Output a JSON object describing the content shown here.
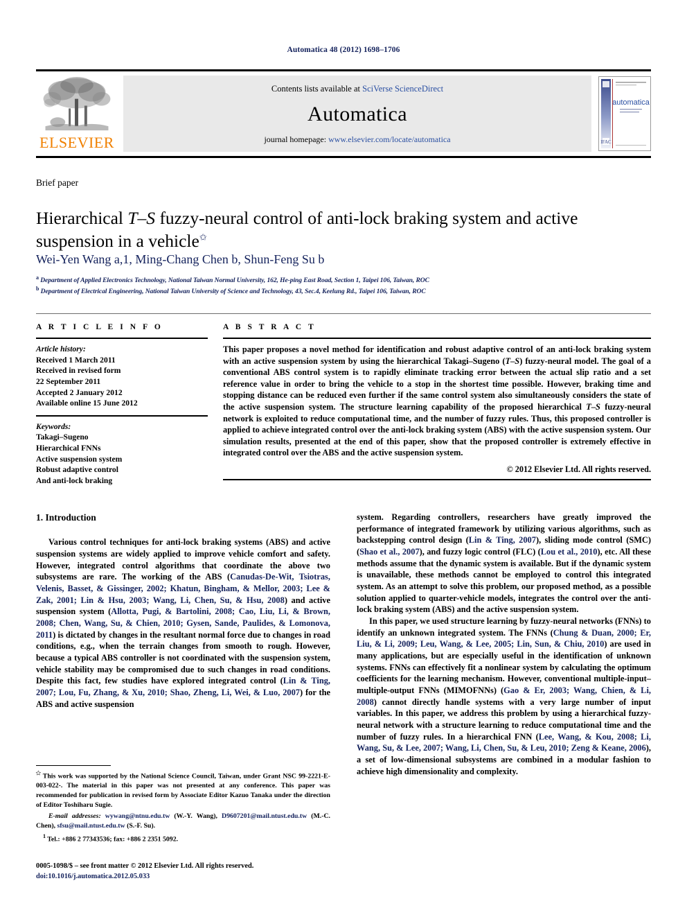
{
  "running_head": "Automatica 48 (2012) 1698–1706",
  "masthead": {
    "contents_prefix": "Contents lists available at ",
    "contents_link": "SciVerse ScienceDirect",
    "journal_name": "Automatica",
    "homepage_prefix": "journal homepage: ",
    "homepage_url": "www.elsevier.com/locate/automatica",
    "publisher": "ELSEVIER",
    "cover_title": "automatica",
    "cover_subtitle_1": "A JOURNAL OF IFAC THE INTERNATIONAL",
    "cover_subtitle_2": "FEDERATION OF AUTOMATIC CONTROL"
  },
  "article": {
    "type_label": "Brief paper",
    "title_part1": "Hierarchical ",
    "title_ts": "T–S",
    "title_part2": " fuzzy-neural control of anti-lock braking system and active suspension in a vehicle",
    "title_star": "✩",
    "authors": "Wei-Yen Wang a,1, Ming-Chang Chen b, Shun-Feng Su b",
    "affiliation_a": "Department of Applied Electronics Technology, National Taiwan Normal University, 162, He-ping East Road, Section 1, Taipei 106, Taiwan, ROC",
    "affiliation_b": "Department of Electrical Engineering, National Taiwan University of Science and Technology, 43, Sec.4, Keelung Rd., Taipei 106, Taiwan, ROC"
  },
  "article_info": {
    "heading": "A R T I C L E   I N F O",
    "history_label": "Article history:",
    "history": [
      "Received 1 March 2011",
      "Received in revised form",
      "22 September 2011",
      "Accepted 2 January 2012",
      "Available online 15 June 2012"
    ],
    "keywords_label": "Keywords:",
    "keywords": [
      "Takagi–Sugeno",
      "Hierarchical FNNs",
      "Active suspension system",
      "Robust adaptive control",
      "And anti-lock braking"
    ]
  },
  "abstract": {
    "heading": "A B S T R A C T",
    "text_1": "This paper proposes a novel method for identification and robust adaptive control of an anti-lock braking system with an active suspension system by using the hierarchical Takagi–Sugeno (",
    "text_ts": "T–S",
    "text_2": ") fuzzy-neural model. The goal of a conventional ABS control system is to rapidly eliminate tracking error between the actual slip ratio and a set reference value in order to bring the vehicle to a stop in the shortest time possible. However, braking time and stopping distance can be reduced even further if the same control system also simultaneously considers the state of the active suspension system. The structure learning capability of the proposed hierarchical ",
    "text_ts2": "T–S",
    "text_3": " fuzzy-neural network is exploited to reduce computational time, and the number of fuzzy rules. Thus, this proposed controller is applied to achieve integrated control over the anti-lock braking system (ABS) with the active suspension system. Our simulation results, presented at the end of this paper, show that the proposed controller is extremely effective in integrated control over the ABS and the active suspension system.",
    "copyright": "© 2012 Elsevier Ltd. All rights reserved."
  },
  "body": {
    "section_heading": "1. Introduction",
    "left_para_1_a": "Various control techniques for anti-lock braking systems (ABS) and active suspension systems are widely applied to improve vehicle comfort and safety. However, integrated control algorithms that coordinate the above two subsystems are rare. The working of the ABS (",
    "left_cite_1": "Canudas-De-Wit, Tsiotras, Velenis, Basset, & Gissinger, 2002; Khatun, Bingham, & Mellor, 2003; Lee & Zak, 2001; Lin & Hsu, 2003; Wang, Li, Chen, Su, & Hsu, 2008",
    "left_para_1_b": ") and active suspension system (",
    "left_cite_2": "Allotta, Pugi, & Bartolini, 2008; Cao, Liu, Li, & Brown, 2008; Chen, Wang, Su, & Chien, 2010; Gysen, Sande, Paulides, & Lomonova, 2011",
    "left_para_1_c": ") is dictated by changes in the resultant normal force due to changes in road conditions, e.g., when the terrain changes from smooth to rough. However, because a typical ABS controller is not coordinated with the suspension system, vehicle stability may be compromised due to such changes in road conditions. Despite this fact, few studies have explored integrated control (",
    "left_cite_3": "Lin & Ting, 2007; Lou, Fu, Zhang, & Xu, 2010; Shao, Zheng, Li, Wei, & Luo, 2007",
    "left_para_1_d": ") for the ABS and active suspension",
    "right_para_1_a": "system. Regarding controllers, researchers have greatly improved the performance of integrated framework by utilizing various algorithms, such as backstepping control design (",
    "right_cite_1": "Lin & Ting, 2007",
    "right_para_1_b": "), sliding mode control (SMC) (",
    "right_cite_2": "Shao et al., 2007",
    "right_para_1_c": "), and fuzzy logic control (FLC) (",
    "right_cite_3": "Lou et al., 2010",
    "right_para_1_d": "), etc. All these methods assume that the dynamic system is available. But if the dynamic system is unavailable, these methods cannot be employed to control this integrated system. As an attempt to solve this problem, our proposed method, as a possible solution applied to quarter-vehicle models, integrates the control over the anti-lock braking system (ABS) and the active suspension system.",
    "right_para_2_a": "In this paper, we used structure learning by fuzzy-neural networks (FNNs) to identify an unknown integrated system. The FNNs (",
    "right_cite_4": "Chung & Duan, 2000; Er, Liu, & Li, 2009; Leu, Wang, & Lee, 2005; Lin, Sun, & Chiu, 2010",
    "right_para_2_b": ") are used in many applications, but are especially useful in the identification of unknown systems. FNNs can effectively fit a nonlinear system by calculating the optimum coefficients for the learning mechanism. However, conventional multiple-input–multiple-output FNNs (MIMOFNNs) (",
    "right_cite_5": "Gao & Er, 2003; Wang, Chien, & Li, 2008",
    "right_para_2_c": ") cannot directly handle systems with a very large number of input variables. In this paper, we address this problem by using a hierarchical fuzzy-neural network with a structure learning to reduce computational time and the number of fuzzy rules. In a hierarchical FNN (",
    "right_cite_6": "Lee, Wang, & Kou, 2008; Li, Wang, Su, & Lee, 2007; Wang, Li, Chen, Su, & Leu, 2010; Zeng & Keane, 2006",
    "right_para_2_d": "), a set of low-dimensional subsystems are combined in a modular fashion to achieve high dimensionality and complexity."
  },
  "footnotes": {
    "star_marker": "✩",
    "star_text": "This work was supported by the National Science Council, Taiwan, under Grant NSC 99-2221-E-003-022-. The material in this paper was not presented at any conference. This paper was recommended for publication in revised form by Associate Editor Kazuo Tanaka under the direction of Editor Toshiharu Sugie.",
    "email_label": "E-mail addresses:",
    "email_1": "wywang@ntnu.edu.tw",
    "email_1_name": "(W.-Y. Wang),",
    "email_2": "D9607201@mail.ntust.edu.tw",
    "email_2_name": "(M.-C. Chen),",
    "email_3": "sfsu@mail.ntust.edu.tw",
    "email_3_name": "(S.-F. Su).",
    "tel_marker": "1",
    "tel_text": "Tel.: +886 2 77343536; fax: +886 2 2351 5092."
  },
  "colophon": {
    "issn_line": "0005-1098/$ – see front matter © 2012 Elsevier Ltd. All rights reserved.",
    "doi_line": "doi:10.1016/j.automatica.2012.05.033"
  },
  "colors": {
    "link_blue": "#2a4fa2",
    "navy": "#14225c",
    "elsevier_orange": "#f08000",
    "band_gray": "#e9e9e9"
  }
}
